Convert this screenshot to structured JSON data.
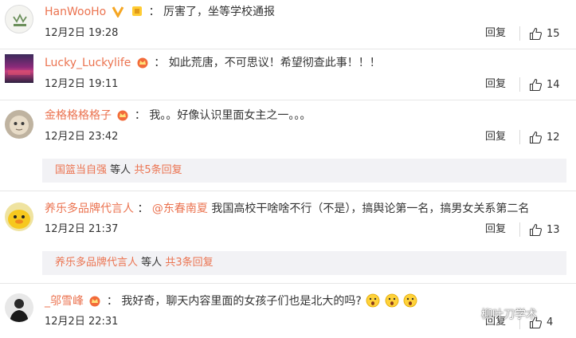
{
  "comments": [
    {
      "username": "HanWooHo",
      "badges": [
        "v-verified-icon",
        "gold-badge-icon"
      ],
      "text": "厉害了，坐等学校通报",
      "time": "12月2日 19:28",
      "reply_label": "回复",
      "likes": "15",
      "avatar": "logo-avatar"
    },
    {
      "username": "Lucky_Luckylife",
      "badges": [
        "vip-crown-icon"
      ],
      "text": "如此荒唐，不可思议！希望彻查此事！！！",
      "time": "12月2日 19:11",
      "reply_label": "回复",
      "likes": "14",
      "avatar": "scene-avatar"
    },
    {
      "username": "金格格格格子",
      "badges": [
        "vip-crown-icon"
      ],
      "text": "我。。好像认识里面女主之一。。。",
      "time": "12月2日 23:42",
      "reply_label": "回复",
      "likes": "12",
      "avatar": "face-avatar",
      "subreplies": {
        "name": "国篮当自强",
        "text": "等人",
        "link": "共5条回复"
      }
    },
    {
      "username": "养乐多品牌代言人",
      "badges": [],
      "mention": "@东春南夏",
      "text": "我国高校干啥啥不行（不是），搞舆论第一名，搞男女关系第二名",
      "time": "12月2日 21:37",
      "reply_label": "回复",
      "likes": "13",
      "avatar": "duck-avatar",
      "subreplies": {
        "name": "养乐多品牌代言人",
        "text": "等人",
        "link": "共3条回复"
      }
    },
    {
      "username": "_邬雪峰",
      "badges": [
        "vip-crown-icon"
      ],
      "text": "我好奇，聊天内容里面的女孩子们也是北大的吗?",
      "emojis": [
        "wow-emoji",
        "wow-emoji",
        "wow-emoji"
      ],
      "time": "12月2日 22:31",
      "reply_label": "回复",
      "likes": "4",
      "avatar": "dark-avatar"
    }
  ],
  "colon": "：",
  "watermark": "柳叶刀学术",
  "colors": {
    "username": "#eb7350",
    "subbox_bg": "#f2f2f5",
    "divider": "#e6e6e6"
  }
}
